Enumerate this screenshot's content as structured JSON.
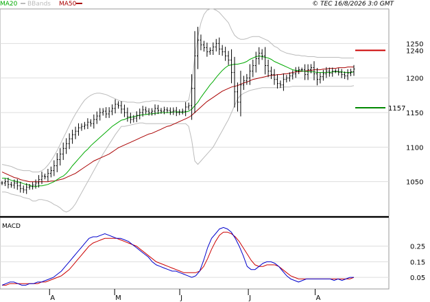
{
  "legend": {
    "ma20": "MA20",
    "bbands": "BBands",
    "ma50": "MA50",
    "copyright": "© TEC 16/8/2026 3:0 GMT"
  },
  "macd": {
    "title": "MACD",
    "ticks": [
      "0.25",
      "0.15",
      "0.05"
    ],
    "tick_values": [
      0.25,
      0.15,
      0.05
    ]
  },
  "markers": {
    "resistance_label": "1240",
    "resistance_value": 1240,
    "resistance_color": "#cc0000",
    "support_label": "1157",
    "support_value": 1157,
    "support_color": "#008800"
  },
  "colors": {
    "price": "#000000",
    "ma20": "#00aa00",
    "ma50": "#aa0000",
    "bbands": "#bbbbbb",
    "macd_line": "#0000cc",
    "signal_line": "#cc0000",
    "grid": "#dddddd",
    "axis": "#999999"
  },
  "chart_data": [
    {
      "type": "ohlc",
      "panel": "price",
      "title": "",
      "ylim": [
        1000,
        1300
      ],
      "y_ticks": [
        1050,
        1100,
        1150,
        1200,
        1250
      ],
      "y_tick_labels": [
        "1050",
        "1100",
        "1150",
        "1200",
        "1250"
      ],
      "x_ticks": [
        "A",
        "M",
        "J",
        "J",
        "A"
      ],
      "grid": true,
      "close": [
        1048,
        1050,
        1046,
        1045,
        1048,
        1044,
        1040,
        1038,
        1042,
        1043,
        1045,
        1048,
        1053,
        1058,
        1057,
        1062,
        1066,
        1073,
        1082,
        1090,
        1098,
        1105,
        1112,
        1118,
        1123,
        1128,
        1130,
        1132,
        1136,
        1134,
        1140,
        1145,
        1150,
        1152,
        1148,
        1152,
        1156,
        1162,
        1160,
        1155,
        1150,
        1144,
        1140,
        1142,
        1146,
        1150,
        1154,
        1152,
        1150,
        1152,
        1156,
        1153,
        1152,
        1154,
        1153,
        1151,
        1153,
        1150,
        1151,
        1152,
        1158,
        1160,
        1185,
        1232,
        1255,
        1248,
        1244,
        1238,
        1240,
        1245,
        1250,
        1242,
        1238,
        1232,
        1226,
        1208,
        1180,
        1165,
        1190,
        1196,
        1200,
        1210,
        1218,
        1228,
        1236,
        1232,
        1218,
        1210,
        1205,
        1198,
        1192,
        1190,
        1198,
        1200,
        1203,
        1206,
        1210,
        1212,
        1212,
        1205,
        1212,
        1215,
        1206,
        1198,
        1202,
        1206,
        1210,
        1207,
        1210,
        1210,
        1208,
        1205,
        1203,
        1207,
        1209,
        1213
      ],
      "ma20": [
        1055,
        1055,
        1054,
        1052,
        1051,
        1050,
        1049,
        1047,
        1046,
        1045,
        1043,
        1043,
        1044,
        1044,
        1045,
        1046,
        1048,
        1050,
        1053,
        1056,
        1058,
        1062,
        1067,
        1073,
        1078,
        1083,
        1088,
        1093,
        1097,
        1102,
        1106,
        1110,
        1114,
        1118,
        1122,
        1126,
        1130,
        1133,
        1136,
        1139,
        1140,
        1142,
        1143,
        1144,
        1145,
        1146,
        1147,
        1147,
        1148,
        1148,
        1149,
        1149,
        1150,
        1150,
        1150,
        1150,
        1151,
        1151,
        1151,
        1150,
        1151,
        1152,
        1155,
        1160,
        1165,
        1172,
        1178,
        1184,
        1190,
        1195,
        1201,
        1206,
        1211,
        1215,
        1218,
        1219,
        1220,
        1220,
        1221,
        1222,
        1224,
        1227,
        1229,
        1231,
        1232,
        1231,
        1230,
        1229,
        1227,
        1224,
        1222,
        1220,
        1218,
        1216,
        1214,
        1212,
        1211,
        1211,
        1210,
        1210,
        1209,
        1209,
        1209,
        1208,
        1208,
        1208,
        1208,
        1208,
        1209,
        1209,
        1209,
        1209,
        1208,
        1208,
        1208,
        1209
      ],
      "ma50": [
        1064,
        1062,
        1060,
        1058,
        1056,
        1055,
        1053,
        1052,
        1051,
        1050,
        1050,
        1050,
        1050,
        1050,
        1050,
        1050,
        1051,
        1051,
        1052,
        1053,
        1054,
        1056,
        1058,
        1060,
        1062,
        1065,
        1068,
        1071,
        1074,
        1077,
        1080,
        1082,
        1084,
        1086,
        1088,
        1090,
        1093,
        1096,
        1099,
        1101,
        1103,
        1105,
        1107,
        1109,
        1111,
        1113,
        1115,
        1117,
        1119,
        1120,
        1122,
        1124,
        1126,
        1128,
        1130,
        1131,
        1133,
        1135,
        1137,
        1139,
        1141,
        1143,
        1146,
        1150,
        1154,
        1158,
        1162,
        1166,
        1169,
        1172,
        1175,
        1178,
        1181,
        1183,
        1185,
        1187,
        1188,
        1189,
        1191,
        1193,
        1194,
        1196,
        1198,
        1199,
        1200,
        1201,
        1202,
        1203,
        1204,
        1204,
        1205,
        1205,
        1206,
        1206,
        1207,
        1208,
        1209,
        1209,
        1210,
        1210,
        1211,
        1211,
        1212,
        1212,
        1212,
        1213,
        1213,
        1214,
        1214,
        1214,
        1215,
        1215,
        1215,
        1216,
        1216,
        1216
      ],
      "bb_upper": [
        1075,
        1074,
        1073,
        1072,
        1070,
        1068,
        1067,
        1066,
        1066,
        1066,
        1064,
        1064,
        1064,
        1066,
        1069,
        1074,
        1080,
        1087,
        1095,
        1104,
        1113,
        1122,
        1131,
        1140,
        1148,
        1155,
        1162,
        1168,
        1172,
        1175,
        1177,
        1178,
        1178,
        1177,
        1176,
        1174,
        1172,
        1170,
        1168,
        1166,
        1166,
        1165,
        1165,
        1165,
        1164,
        1164,
        1165,
        1166,
        1166,
        1167,
        1167,
        1167,
        1166,
        1166,
        1166,
        1166,
        1166,
        1166,
        1166,
        1166,
        1166,
        1168,
        1190,
        1230,
        1260,
        1280,
        1292,
        1298,
        1300,
        1300,
        1298,
        1295,
        1290,
        1285,
        1280,
        1270,
        1262,
        1258,
        1256,
        1256,
        1257,
        1259,
        1260,
        1260,
        1260,
        1258,
        1256,
        1254,
        1250,
        1246,
        1244,
        1240,
        1238,
        1236,
        1235,
        1234,
        1233,
        1233,
        1232,
        1232,
        1231,
        1231,
        1231,
        1230,
        1230,
        1230,
        1230,
        1230,
        1230,
        1230,
        1230,
        1229,
        1229,
        1229,
        1229,
        1229
      ],
      "bb_lower": [
        1035,
        1035,
        1034,
        1032,
        1031,
        1030,
        1029,
        1027,
        1026,
        1025,
        1022,
        1022,
        1024,
        1024,
        1023,
        1022,
        1020,
        1017,
        1015,
        1012,
        1008,
        1006,
        1008,
        1012,
        1018,
        1026,
        1034,
        1042,
        1050,
        1058,
        1066,
        1074,
        1082,
        1090,
        1097,
        1104,
        1111,
        1118,
        1124,
        1130,
        1130,
        1131,
        1132,
        1133,
        1134,
        1135,
        1135,
        1134,
        1134,
        1134,
        1134,
        1134,
        1134,
        1134,
        1134,
        1134,
        1134,
        1134,
        1134,
        1134,
        1134,
        1130,
        1110,
        1080,
        1075,
        1080,
        1085,
        1090,
        1095,
        1100,
        1108,
        1116,
        1124,
        1132,
        1140,
        1150,
        1160,
        1170,
        1175,
        1178,
        1180,
        1182,
        1183,
        1184,
        1185,
        1186,
        1186,
        1186,
        1186,
        1186,
        1186,
        1186,
        1187,
        1187,
        1187,
        1188,
        1188,
        1188,
        1188,
        1188,
        1188,
        1188,
        1188,
        1188,
        1188,
        1188,
        1188,
        1188,
        1188,
        1188,
        1188,
        1188,
        1188,
        1188,
        1188,
        1189
      ]
    },
    {
      "type": "line",
      "panel": "macd",
      "title": "MACD",
      "ylim": [
        -0.02,
        0.42
      ],
      "y_ticks": [
        0.25,
        0.15,
        0.05
      ],
      "x_ticks": [
        "A",
        "M",
        "J",
        "J",
        "A"
      ],
      "series": [
        {
          "name": "MACD",
          "color": "#0000cc"
        },
        {
          "name": "Signal",
          "color": "#cc0000"
        }
      ],
      "macd": [
        0.0,
        0.01,
        0.02,
        0.02,
        0.01,
        0.0,
        0.0,
        0.01,
        0.01,
        0.02,
        0.02,
        0.03,
        0.04,
        0.05,
        0.07,
        0.09,
        0.12,
        0.15,
        0.18,
        0.21,
        0.24,
        0.27,
        0.3,
        0.31,
        0.31,
        0.32,
        0.33,
        0.32,
        0.31,
        0.3,
        0.3,
        0.29,
        0.28,
        0.26,
        0.24,
        0.22,
        0.2,
        0.18,
        0.15,
        0.13,
        0.12,
        0.11,
        0.1,
        0.09,
        0.09,
        0.08,
        0.07,
        0.06,
        0.05,
        0.06,
        0.09,
        0.16,
        0.24,
        0.3,
        0.33,
        0.36,
        0.37,
        0.36,
        0.34,
        0.3,
        0.25,
        0.19,
        0.12,
        0.1,
        0.1,
        0.12,
        0.14,
        0.15,
        0.15,
        0.14,
        0.12,
        0.09,
        0.06,
        0.04,
        0.03,
        0.02,
        0.03,
        0.04,
        0.04,
        0.04,
        0.04,
        0.04,
        0.04,
        0.04,
        0.03,
        0.04,
        0.03,
        0.04,
        0.05,
        0.05
      ],
      "signal": [
        0.0,
        0.0,
        0.01,
        0.01,
        0.01,
        0.01,
        0.01,
        0.01,
        0.01,
        0.01,
        0.02,
        0.02,
        0.03,
        0.04,
        0.05,
        0.06,
        0.08,
        0.1,
        0.13,
        0.16,
        0.19,
        0.22,
        0.25,
        0.27,
        0.28,
        0.29,
        0.3,
        0.3,
        0.3,
        0.3,
        0.29,
        0.28,
        0.27,
        0.26,
        0.25,
        0.23,
        0.21,
        0.19,
        0.17,
        0.15,
        0.14,
        0.13,
        0.12,
        0.11,
        0.1,
        0.09,
        0.08,
        0.08,
        0.08,
        0.08,
        0.09,
        0.12,
        0.17,
        0.23,
        0.28,
        0.32,
        0.34,
        0.34,
        0.33,
        0.31,
        0.28,
        0.24,
        0.2,
        0.16,
        0.13,
        0.12,
        0.12,
        0.13,
        0.13,
        0.13,
        0.12,
        0.1,
        0.08,
        0.06,
        0.05,
        0.04,
        0.04,
        0.04,
        0.04,
        0.04,
        0.04,
        0.04,
        0.04,
        0.04,
        0.04,
        0.04,
        0.04,
        0.04,
        0.04,
        0.05
      ]
    }
  ]
}
